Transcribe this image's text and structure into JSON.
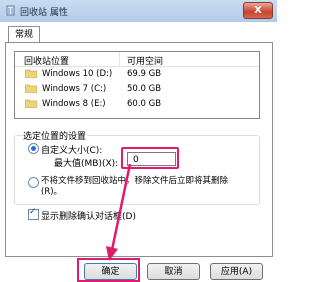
{
  "window": {
    "title": "回收站 属性",
    "close_glyph": "X"
  },
  "tabs": [
    {
      "label": "常规"
    }
  ],
  "list": {
    "headers": {
      "location": "回收站位置",
      "space": "可用空间"
    },
    "rows": [
      {
        "location": "Windows 10 (D:)",
        "space": "69.9 GB"
      },
      {
        "location": "Windows 7 (C:)",
        "space": "50.0 GB"
      },
      {
        "location": "Windows 8 (E:)",
        "space": "60.0 GB"
      }
    ]
  },
  "settings": {
    "group_title": "选定位置的设置",
    "custom_size_label": "自定义大小(C):",
    "max_size_label": "最大值(MB)(X):",
    "max_size_value": "0",
    "no_move_label": "不将文件移到回收站中。移除文件后立即将其删除(R)。",
    "confirm_delete_label": "显示删除确认对话框(D)"
  },
  "buttons": {
    "ok": "确定",
    "cancel": "取消",
    "apply": "应用(A)"
  },
  "colors": {
    "highlight": "#e01a6e",
    "titlebar": "#c9dcf1"
  }
}
